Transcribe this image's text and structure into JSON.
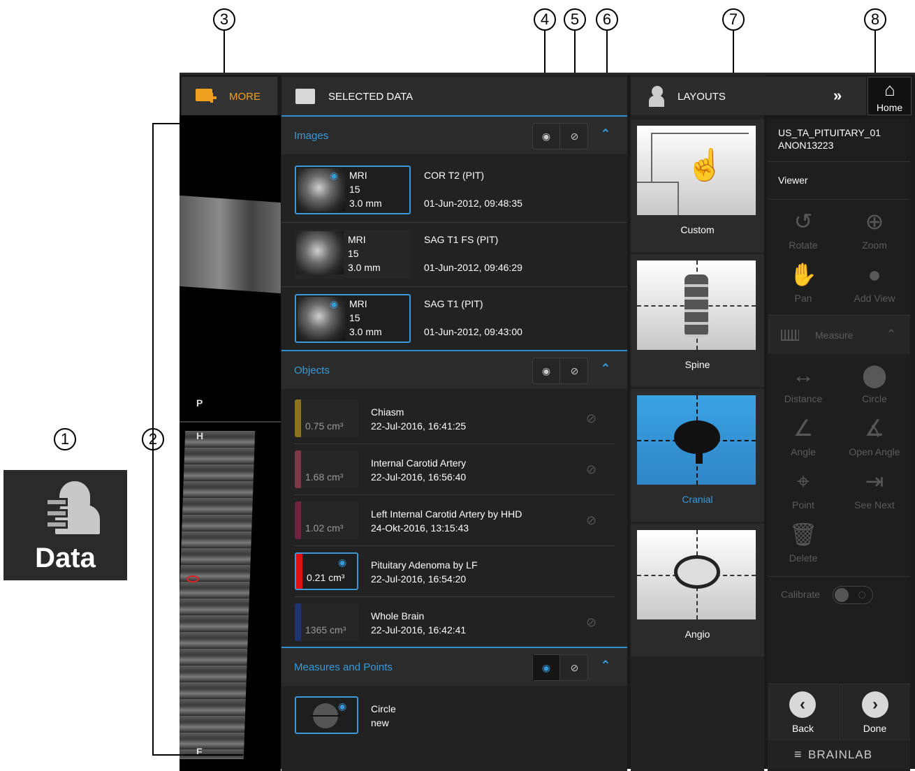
{
  "callouts": [
    "1",
    "2",
    "3",
    "4",
    "5",
    "6",
    "7",
    "8"
  ],
  "data_tile": {
    "label": "Data",
    "icon": "data-person-icon"
  },
  "viewer": {
    "orientation_top": "P",
    "orientation_mid": "H",
    "orientation_bottom": "F"
  },
  "more": {
    "label": "MORE",
    "icon": "add-folder-icon"
  },
  "selected_data": {
    "title": "SELECTED DATA",
    "images": {
      "title": "Images",
      "rows": [
        {
          "modality": "MRI",
          "count": "15",
          "thickness": "3.0 mm",
          "name": "COR T2 (PIT)",
          "date": "01-Jun-2012, 09:48:35",
          "selected": true
        },
        {
          "modality": "MRI",
          "count": "15",
          "thickness": "3.0 mm",
          "name": "SAG T1 FS (PIT)",
          "date": "01-Jun-2012, 09:46:29",
          "selected": false
        },
        {
          "modality": "MRI",
          "count": "15",
          "thickness": "3.0 mm",
          "name": "SAG T1 (PIT)",
          "date": "01-Jun-2012, 09:43:00",
          "selected": true
        }
      ]
    },
    "objects": {
      "title": "Objects",
      "rows": [
        {
          "volume": "0.75 cm³",
          "name": "Chiasm",
          "date": "22-Jul-2016, 16:41:25",
          "color": "#8a7420",
          "selected": false
        },
        {
          "volume": "1.68 cm³",
          "name": "Internal Carotid Artery",
          "date": "22-Jul-2016, 16:56:40",
          "color": "#7a3a48",
          "selected": false
        },
        {
          "volume": "1.02 cm³",
          "name": "Left Internal Carotid Artery by HHD",
          "date": "24-Okt-2016, 13:15:43",
          "color": "#6e2440",
          "selected": false
        },
        {
          "volume": "0.21 cm³",
          "name": "Pituitary Adenoma by LF",
          "date": "22-Jul-2016, 16:54:20",
          "color": "#e01010",
          "selected": true
        },
        {
          "volume": "1365 cm³",
          "name": "Whole Brain",
          "date": "22-Jul-2016, 16:42:41",
          "color": "#1d3470",
          "selected": false
        }
      ]
    },
    "measures": {
      "title": "Measures and Points",
      "rows": [
        {
          "name": "Circle",
          "sub": "new"
        }
      ]
    }
  },
  "layouts": {
    "title": "LAYOUTS",
    "cards": [
      {
        "label": "Custom",
        "selected": false
      },
      {
        "label": "Spine",
        "selected": false
      },
      {
        "label": "Cranial",
        "selected": true
      },
      {
        "label": "Angio",
        "selected": false
      }
    ]
  },
  "home": {
    "label": "Home"
  },
  "patient": {
    "name": "US_TA_PITUITARY_01",
    "id": "ANON13223"
  },
  "viewer_section": {
    "label": "Viewer"
  },
  "tools": {
    "rotate": "Rotate",
    "zoom": "Zoom",
    "pan": "Pan",
    "add_view": "Add View",
    "measure": "Measure",
    "distance": "Distance",
    "circle": "Circle",
    "angle": "Angle",
    "open_angle": "Open Angle",
    "point": "Point",
    "see_next": "See Next",
    "delete": "Delete",
    "calibrate": "Calibrate"
  },
  "footer": {
    "back": "Back",
    "done": "Done",
    "brand": "BRAINLAB"
  },
  "colors": {
    "accent": "#3a9ad9",
    "more": "#f0a020",
    "panel": "#2b2b2b"
  }
}
